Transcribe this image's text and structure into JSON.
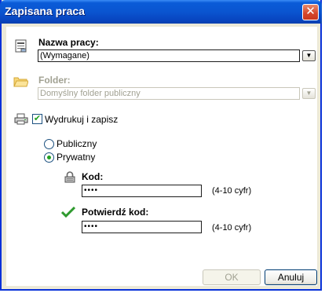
{
  "window": {
    "title": "Zapisana praca",
    "close_glyph": "✕"
  },
  "job_name": {
    "label": "Nazwa pracy:",
    "value": "(Wymagane)",
    "icon": "document-icon",
    "dropdown_glyph": "▼"
  },
  "folder": {
    "label": "Folder:",
    "value": "Domyślny folder publiczny",
    "icon": "folder-icon",
    "enabled": false,
    "dropdown_glyph": "▼"
  },
  "print_and_save": {
    "label": "Wydrukuj i zapisz",
    "checked": true,
    "check_glyph": "✔",
    "icon": "printer-icon"
  },
  "visibility": {
    "options": [
      "Publiczny",
      "Prywatny"
    ],
    "selected": "Prywatny"
  },
  "code": {
    "label": "Kod:",
    "value": "••••",
    "hint": "(4-10 cyfr)",
    "icon": "lock-icon"
  },
  "confirm_code": {
    "label": "Potwierdź kod:",
    "value": "••••",
    "hint": "(4-10 cyfr)",
    "icon": "checkmark-icon"
  },
  "buttons": {
    "ok": "OK",
    "cancel": "Anuluj",
    "ok_enabled": false
  },
  "colors": {
    "titlebar": "#0a55d0",
    "dialog_bg": "#ece9d8",
    "content_bg": "#ffffff",
    "disabled_text": "#a1a192",
    "check_green": "#21a121"
  }
}
